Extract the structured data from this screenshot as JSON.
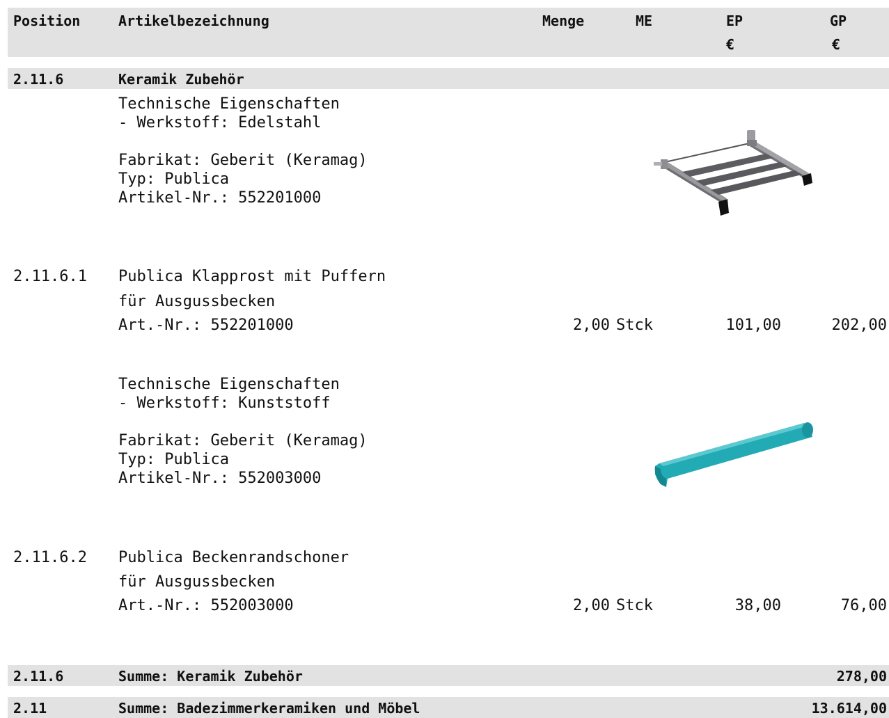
{
  "header": {
    "position": "Position",
    "artikel": "Artikelbezeichnung",
    "menge": "Menge",
    "me": "ME",
    "ep": "EP",
    "ep_currency": "€",
    "gp": "GP",
    "gp_currency": "€"
  },
  "group": {
    "number": "2.11.6",
    "title": "Keramik Zubehör"
  },
  "items": [
    {
      "spec_title": "Technische Eigenschaften",
      "spec_material": "- Werkstoff: Edelstahl",
      "fabrikat": "Fabrikat: Geberit (Keramag)",
      "typ": "Typ: Publica",
      "artikel_nr": "Artikel-Nr.: 552201000",
      "position": "2.11.6.1",
      "name_line1": "Publica Klapprost mit Puffern",
      "name_line2": "für Ausgussbecken",
      "art_nr": "Art.-Nr.: 552201000",
      "menge": "2,00",
      "me": "Stck",
      "ep": "101,00",
      "gp": "202,00",
      "image_icon": "folding-grate-image"
    },
    {
      "spec_title": "Technische Eigenschaften",
      "spec_material": "- Werkstoff: Kunststoff",
      "fabrikat": "Fabrikat: Geberit (Keramag)",
      "typ": "Typ: Publica",
      "artikel_nr": "Artikel-Nr.: 552003000",
      "position": "2.11.6.2",
      "name_line1": "Publica Beckenrandschoner",
      "name_line2": "für Ausgussbecken",
      "art_nr": "Art.-Nr.: 552003000",
      "menge": "2,00",
      "me": "Stck",
      "ep": "38,00",
      "gp": "76,00",
      "image_icon": "rim-protector-image",
      "image_color": "#1fa9b4"
    }
  ],
  "sums": [
    {
      "number": "2.11.6",
      "label": "Summe: Keramik Zubehör",
      "value": "278,00"
    },
    {
      "number": "2.11",
      "label": "Summe: Badezimmerkeramiken und Möbel",
      "value": "13.614,00"
    }
  ]
}
